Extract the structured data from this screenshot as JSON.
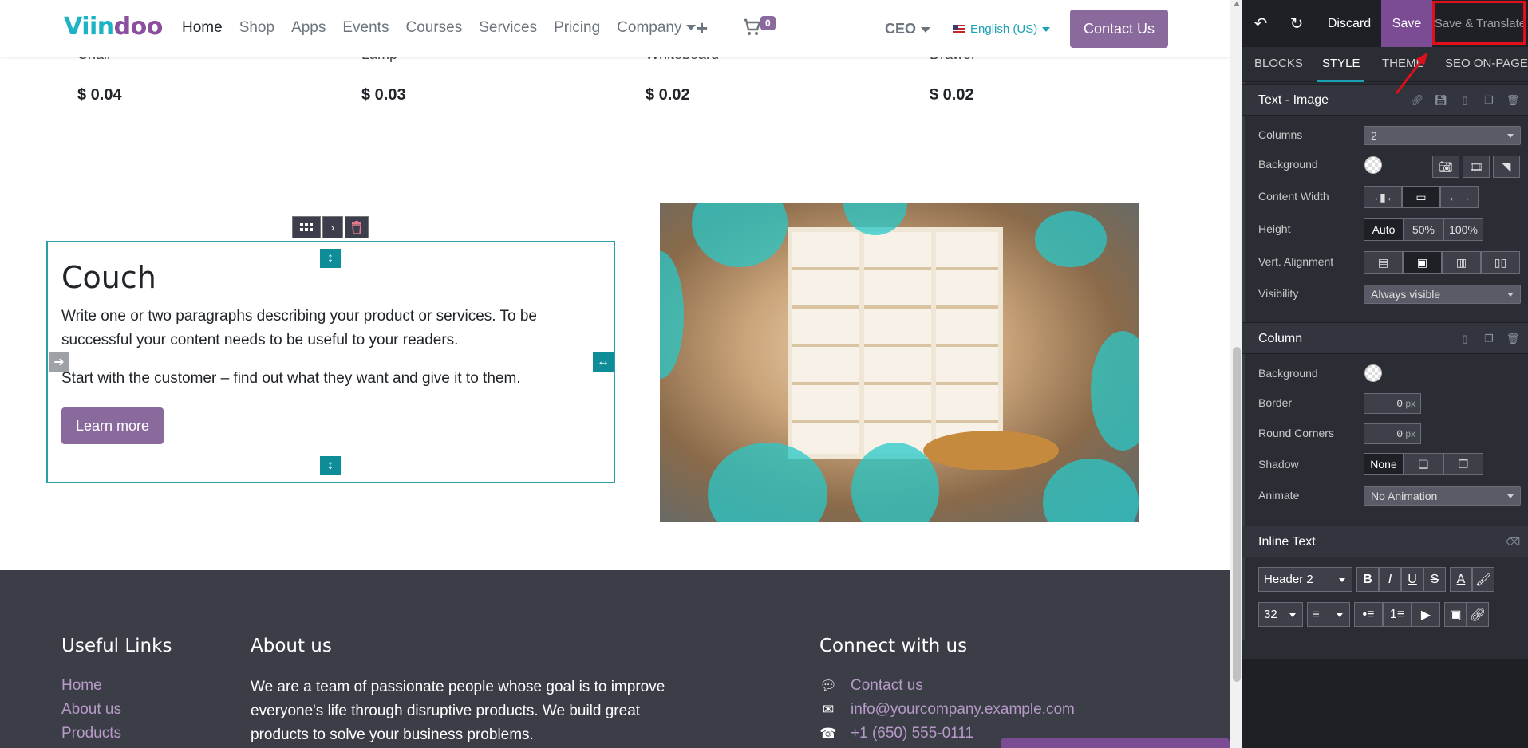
{
  "site": {
    "logo_part1": "Viin",
    "logo_part2": "doo",
    "nav": [
      "Home",
      "Shop",
      "Apps",
      "Events",
      "Courses",
      "Services",
      "Pricing",
      "Company"
    ],
    "cart_count": "0",
    "user": "CEO",
    "language": "English (US)",
    "contact_button": "Contact Us",
    "products": [
      {
        "name": "Chair",
        "price": "$ 0.04"
      },
      {
        "name": "Lamp",
        "price": "$ 0.03"
      },
      {
        "name": "Whiteboard",
        "price": "$ 0.02"
      },
      {
        "name": "Drawer",
        "price": "$ 0.02"
      }
    ],
    "snippet": {
      "title": "Couch",
      "paragraph1": "Write one or two paragraphs describing your product or services. To be successful your content needs to be useful to your readers.",
      "paragraph2": "Start with the customer – find out what they want and give it to them.",
      "button": "Learn more"
    },
    "footer": {
      "useful_links_heading": "Useful Links",
      "useful_links": [
        "Home",
        "About us",
        "Products"
      ],
      "about_heading": "About us",
      "about_text": "We are a team of passionate people whose goal is to improve everyone's life through disruptive products. We build great products to solve your business problems.",
      "connect_heading": "Connect with us",
      "contacts": [
        {
          "icon": "chat-icon",
          "text": "Contact us"
        },
        {
          "icon": "envelope-icon",
          "text": "info@yourcompany.example.com"
        },
        {
          "icon": "phone-icon",
          "text": "+1 (650) 555-0111"
        }
      ]
    }
  },
  "editor": {
    "discard": "Discard",
    "save": "Save",
    "save_translate": "Save & Translate",
    "tabs": [
      "BLOCKS",
      "STYLE",
      "THEME",
      "SEO ON-PAGE"
    ],
    "active_tab": "STYLE",
    "text_image_section": {
      "title": "Text - Image",
      "columns_label": "Columns",
      "columns_value": "2",
      "background_label": "Background",
      "content_width_label": "Content Width",
      "height_label": "Height",
      "height_options": [
        "Auto",
        "50%",
        "100%"
      ],
      "vert_alignment_label": "Vert. Alignment",
      "visibility_label": "Visibility",
      "visibility_value": "Always visible"
    },
    "column_section": {
      "title": "Column",
      "background_label": "Background",
      "border_label": "Border",
      "border_value": "0",
      "round_corners_label": "Round Corners",
      "round_corners_value": "0",
      "unit": "px",
      "shadow_label": "Shadow",
      "shadow_none": "None",
      "animate_label": "Animate",
      "animate_value": "No Animation"
    },
    "inline_text_section": {
      "title": "Inline Text",
      "style_value": "Header 2",
      "font_size_value": "32"
    }
  },
  "colors": {
    "brand_purple": "#8a6a9c",
    "teal": "#1ca3b3",
    "editor_bg": "#2b2d35",
    "highlight_red": "#e0101a"
  }
}
